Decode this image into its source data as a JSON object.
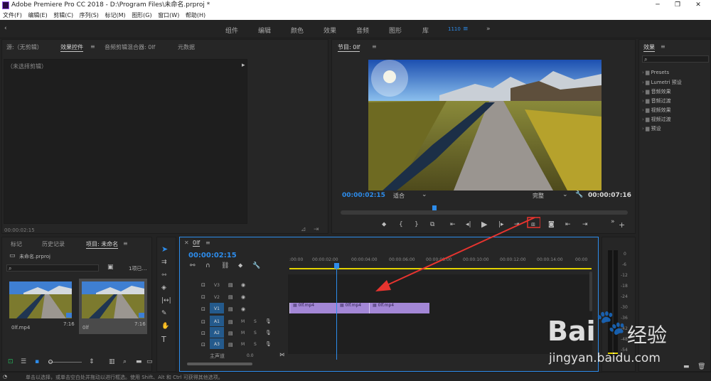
{
  "window": {
    "title": "Adobe Premiere Pro CC 2018 - D:\\Program Files\\未命名.prproj *"
  },
  "menu": [
    "文件(F)",
    "编辑(E)",
    "剪辑(C)",
    "序列(S)",
    "标记(M)",
    "图形(G)",
    "窗口(W)",
    "帮助(H)"
  ],
  "workspaces": [
    "组件",
    "编辑",
    "颜色",
    "效果",
    "音频",
    "图形",
    "库",
    "1110",
    "»"
  ],
  "source_panel": {
    "tabs": [
      "源:（无剪辑）",
      "效果控件",
      "音频剪辑混合器: 0lf",
      "元数据"
    ],
    "no_clip_text": "（未选择剪辑）",
    "timecode": "00:00:02:15"
  },
  "program_monitor": {
    "title": "节目: 0lf",
    "timecode_current": "00:00:02:15",
    "fit_label": "适合",
    "quality_label": "完整",
    "timecode_total": "00:00:07:16"
  },
  "effects_panel": {
    "title": "效果",
    "items": [
      "Presets",
      "Lumetri 预设",
      "音频效果",
      "音频过渡",
      "视频效果",
      "视频过渡",
      "预设"
    ]
  },
  "project_panel": {
    "tabs": [
      "标记",
      "历史记录",
      "项目: 未命名"
    ],
    "project_file": "未命名.prproj",
    "item_count": "1项已…",
    "items": [
      {
        "name": "0lf.mp4",
        "duration": "7:16"
      },
      {
        "name": "0lf",
        "duration": "7:16"
      }
    ]
  },
  "timeline": {
    "sequence_name": "0lf",
    "timecode": "00:00:02:15",
    "ruler": [
      ":00:00",
      "00:00:02:00",
      "00:00:04:00",
      "00:00:06:00",
      "00:00:08:00",
      "00:00:10:00",
      "00:00:12:00",
      "00:00:14:00",
      "00:00"
    ],
    "video_tracks": [
      "V3",
      "V2",
      "V1"
    ],
    "audio_tracks": [
      "A1",
      "A2",
      "A3"
    ],
    "master_label": "主声道",
    "master_value": "0.0",
    "clips": [
      "0lf.mp4",
      "0lf.mp4",
      "0lf.mp4"
    ],
    "track_buttons": {
      "mute": "M",
      "solo": "S"
    }
  },
  "meter_scale": [
    "0",
    "-6",
    "-12",
    "-18",
    "-24",
    "-30",
    "-36",
    "-42",
    "-48",
    "-54"
  ],
  "status_bar": {
    "text": "单击以选择，或单击空白处并拖动以进行框选。使用 Shift、Alt 和 Ctrl 可获得其他选项。"
  },
  "watermark": {
    "brand": "Bai",
    "brand_cn": "经验",
    "url": "jingyan.baidu.com"
  },
  "colors": {
    "accent_blue": "#2d8ceb",
    "clip_purple": "#a387d6",
    "arrow_red": "#e8342f",
    "work_area_yellow": "#e4d400"
  }
}
